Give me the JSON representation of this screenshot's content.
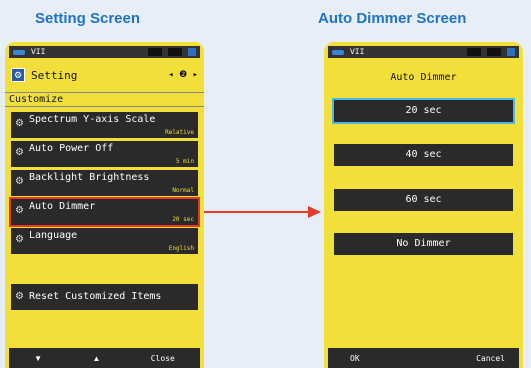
{
  "captions": {
    "left": "Setting Screen",
    "right": "Auto Dimmer Screen"
  },
  "status": {
    "number": "VII"
  },
  "setting": {
    "title": "Setting",
    "page_indicator": "◂ ❷ ▸",
    "section": "Customize",
    "items": [
      {
        "label": "Spectrum Y-axis Scale",
        "value": "Relative"
      },
      {
        "label": "Auto Power Off",
        "value": "5 min"
      },
      {
        "label": "Backlight Brightness",
        "value": "Normal"
      },
      {
        "label": "Auto Dimmer",
        "value": "20 sec"
      },
      {
        "label": "Language",
        "value": "English"
      },
      {
        "label": "Reset Customized Items",
        "value": ""
      }
    ],
    "nav": {
      "down": "▼",
      "up": "▲",
      "close": "Close"
    }
  },
  "dimmer": {
    "title": "Auto Dimmer",
    "options": [
      "20 sec",
      "40 sec",
      "60 sec",
      "No Dimmer"
    ],
    "selected_index": 0,
    "nav": {
      "ok": "OK",
      "cancel": "Cancel"
    }
  },
  "colors": {
    "screen_bg": "#f2df3a",
    "caption": "#1f73c8",
    "highlight": "#e53a2b",
    "active_option": "#4ab4e6"
  }
}
